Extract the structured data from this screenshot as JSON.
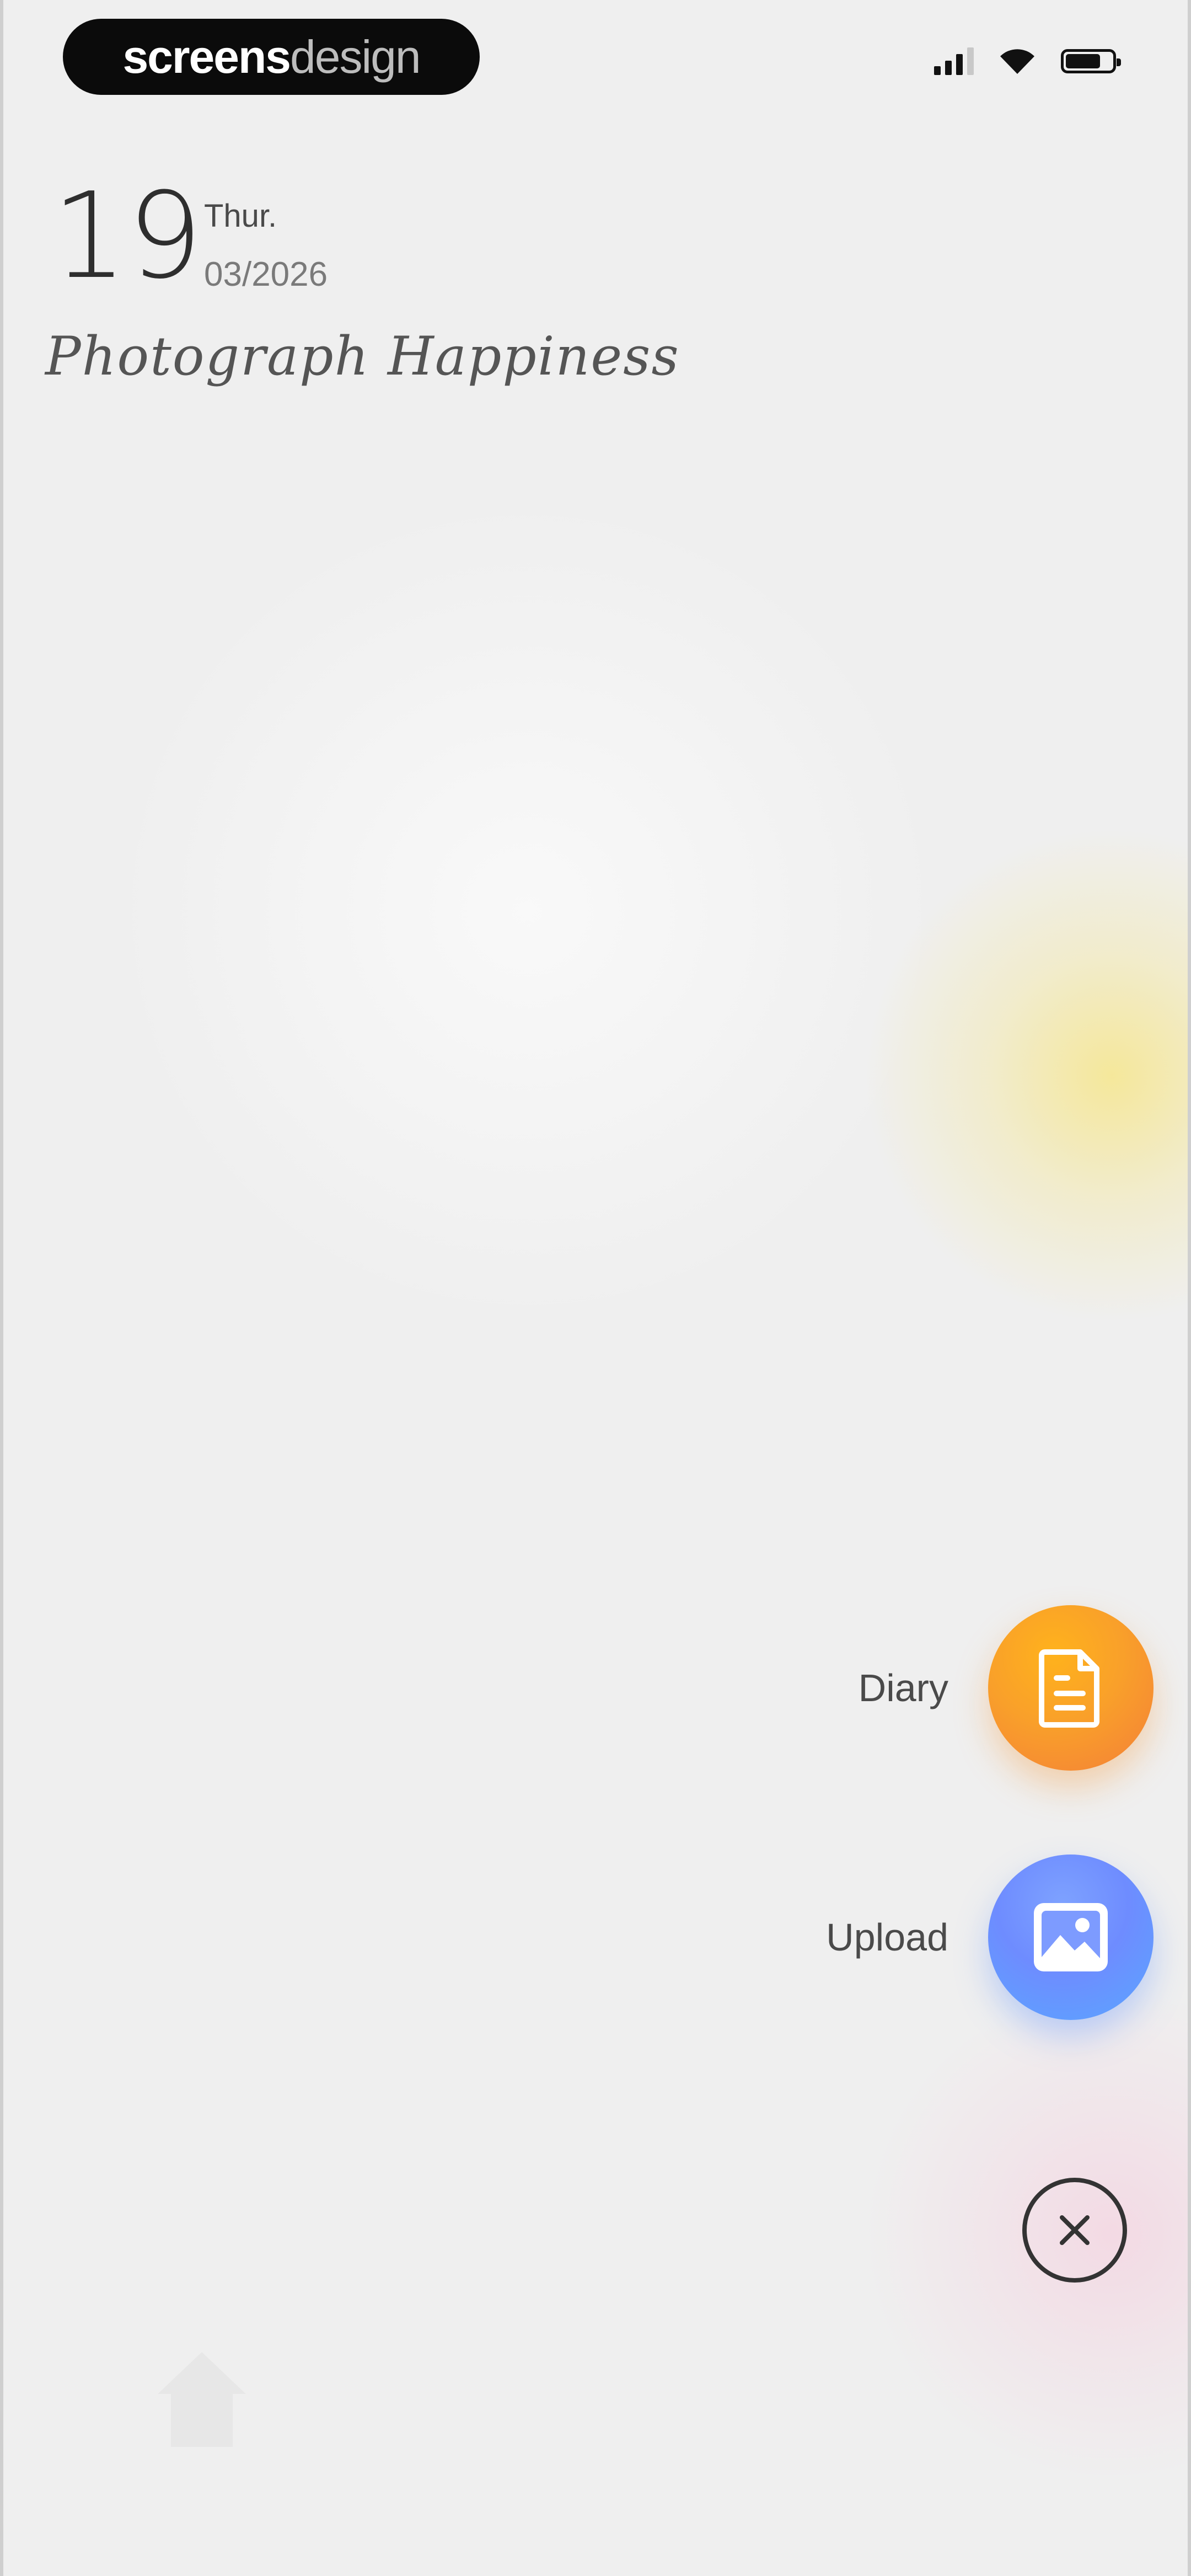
{
  "status_bar": {
    "brand_part1": "screens",
    "brand_part2": "design"
  },
  "header": {
    "day": "19",
    "weekday": "Thur.",
    "month_year": "03/2026",
    "tagline": "Photograph Happiness"
  },
  "actions": {
    "diary_label": "Diary",
    "upload_label": "Upload"
  },
  "colors": {
    "background": "#efefef",
    "diary_accent": "#f9a02a",
    "upload_accent": "#6e8cff",
    "text_dark": "#2e2e2e"
  },
  "icons": {
    "diary": "document-icon",
    "upload": "image-icon",
    "close": "close-circle-icon"
  }
}
